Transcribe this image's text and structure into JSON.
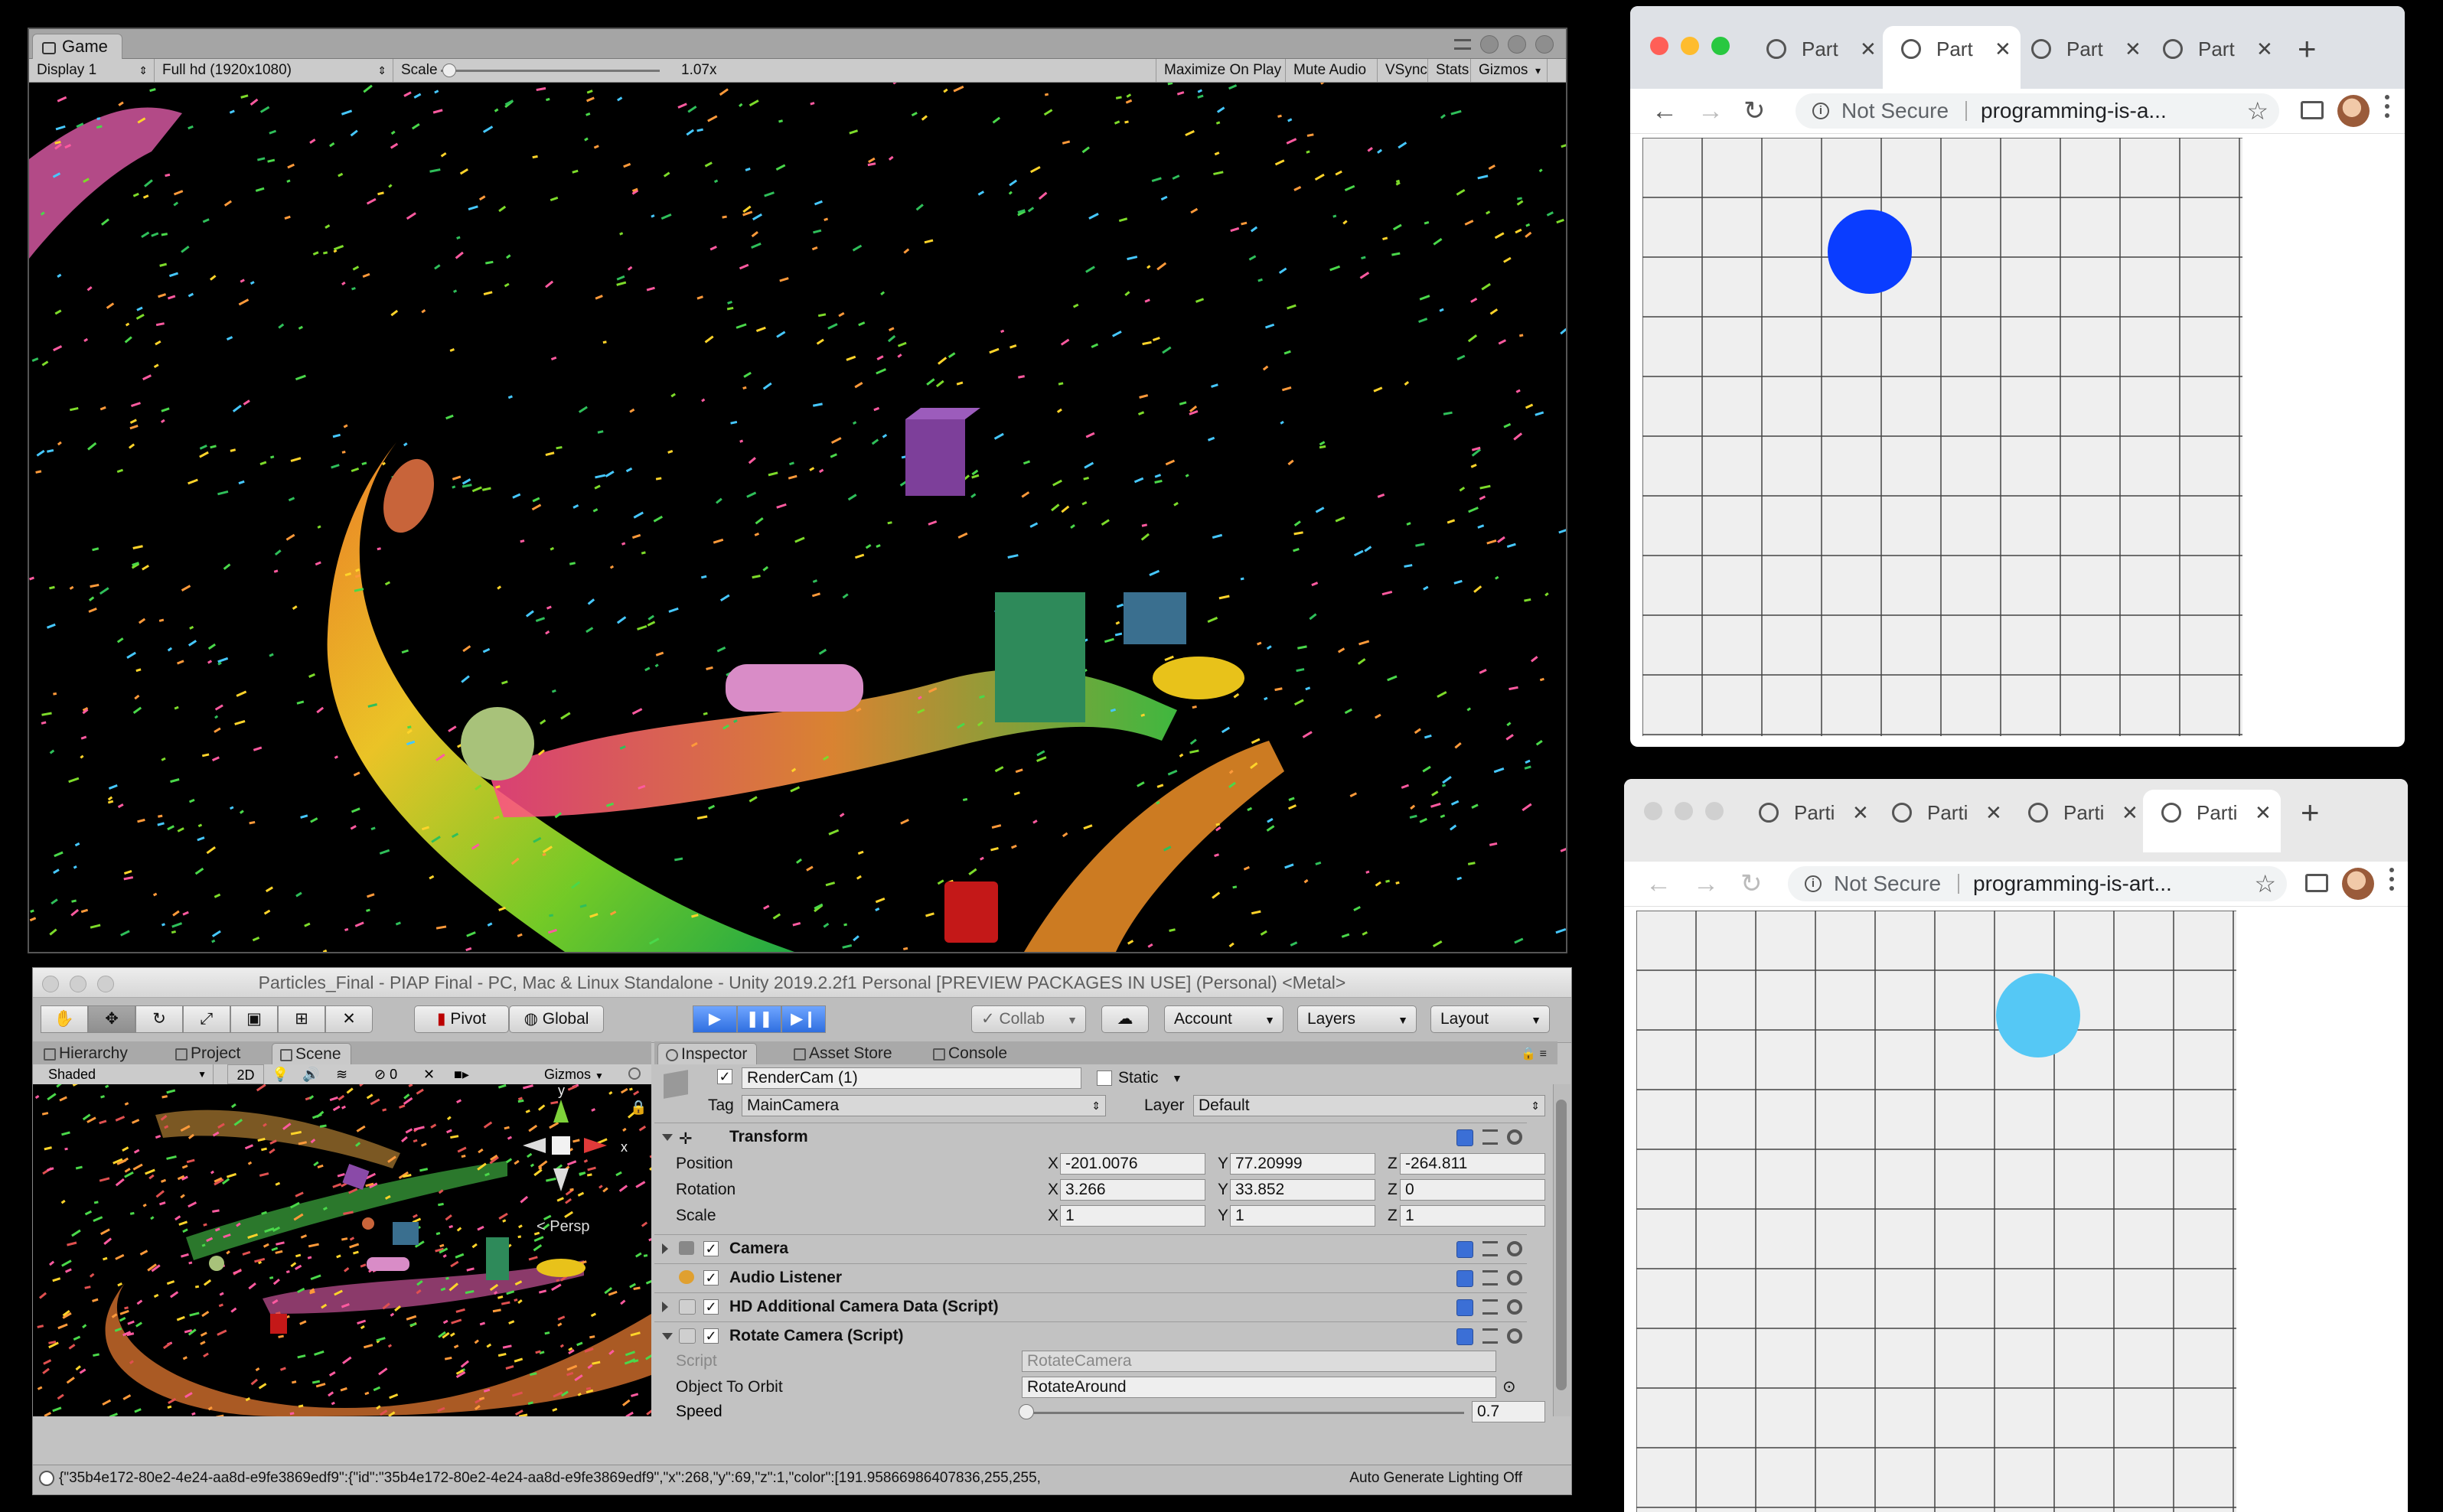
{
  "game_window": {
    "tab_label": "Game",
    "display": "Display 1",
    "resolution": "Full hd (1920x1080)",
    "scale_label": "Scale",
    "scale_value": "1.07x",
    "buttons": [
      "Maximize On Play",
      "Mute Audio",
      "VSync",
      "Stats",
      "Gizmos"
    ]
  },
  "editor": {
    "title": "Particles_Final - PIAP Final - PC, Mac & Linux Standalone - Unity 2019.2.2f1 Personal [PREVIEW PACKAGES IN USE] (Personal) <Metal>",
    "pivot": "Pivot",
    "global": "Global",
    "collab": "Collab",
    "account": "Account",
    "layers": "Layers",
    "layout": "Layout",
    "left_tabs": [
      "Hierarchy",
      "Project",
      "Scene"
    ],
    "right_tabs": [
      "Inspector",
      "Asset Store",
      "Console"
    ],
    "scene_bar": {
      "shading": "Shaded",
      "mode_2d": "2D",
      "hidden_count": "0",
      "gizmos": "Gizmos",
      "persp": "< Persp",
      "axis_y": "y",
      "axis_x": "x"
    },
    "inspector": {
      "object_name": "RenderCam (1)",
      "static_label": "Static",
      "tag_label": "Tag",
      "tag_value": "MainCamera",
      "layer_label": "Layer",
      "layer_value": "Default",
      "transform": {
        "title": "Transform",
        "position": {
          "label": "Position",
          "x": "-201.0076",
          "y": "77.20999",
          "z": "-264.811"
        },
        "rotation": {
          "label": "Rotation",
          "x": "3.266",
          "y": "33.852",
          "z": "0"
        },
        "scale": {
          "label": "Scale",
          "x": "1",
          "y": "1",
          "z": "1"
        }
      },
      "components": [
        "Camera",
        "Audio Listener",
        "HD Additional Camera Data (Script)",
        "Rotate Camera (Script)"
      ],
      "script_label": "Script",
      "script_value": "RotateCamera",
      "orbit_label": "Object To Orbit",
      "orbit_value": "RotateAround",
      "speed_label": "Speed",
      "speed_value": "0.7",
      "speed_fraction": 0.0
    },
    "status_text": "{\"35b4e172-80e2-4e24-aa8d-e9fe3869edf9\":{\"id\":\"35b4e172-80e2-4e24-aa8d-e9fe3869edf9\",\"x\":268,\"y\":69,\"z\":1,\"color\":[191.95866986407836,255,255,",
    "status_right": "Auto Generate Lighting Off"
  },
  "browser_top": {
    "tabs": [
      "Part",
      "Part",
      "Part",
      "Part"
    ],
    "active_tab": 1,
    "security": "Not Secure",
    "url": "programming-is-a...",
    "circle_color": "#0a3dff"
  },
  "browser_bottom": {
    "tabs": [
      "Parti",
      "Parti",
      "Parti",
      "Parti"
    ],
    "active_tab": 3,
    "security": "Not Secure",
    "url": "programming-is-art...",
    "circle_color": "#55c8f5"
  }
}
